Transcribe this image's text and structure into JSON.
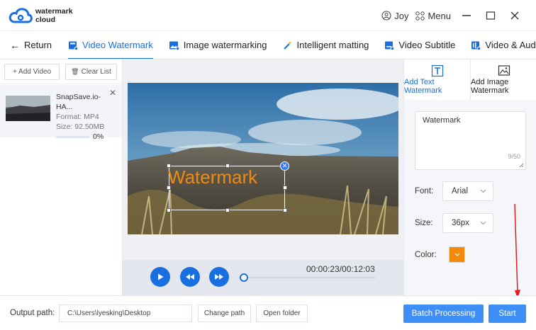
{
  "app": {
    "logo_line1": "watermark",
    "logo_line2": "cloud",
    "brand_color": "#1a6fe0"
  },
  "header": {
    "user_name": "Joy",
    "menu_label": "Menu"
  },
  "tabs": {
    "return_label": "Return",
    "items": [
      {
        "label": "Video Watermark",
        "active": true
      },
      {
        "label": "Image watermarking",
        "active": false
      },
      {
        "label": "Intelligent matting",
        "active": false
      },
      {
        "label": "Video Subtitle",
        "active": false
      },
      {
        "label": "Video & Audio Sepa",
        "active": false
      }
    ]
  },
  "left": {
    "add_video": "+ Add Video",
    "clear_list": "Clear List",
    "file": {
      "name": "SnapSave.io-HA...",
      "format": "Format:  MP4",
      "size": "Size:  92.50MB",
      "progress_text": "0%",
      "progress": 0
    }
  },
  "preview": {
    "watermark_text": "Watermark",
    "watermark_color": "#f08a10",
    "time": "00:00:23/00:12:03"
  },
  "right": {
    "tab_text": "Add Text Watermark",
    "tab_image": "Add Image Watermark",
    "text_value": "Watermark",
    "counter": "9/50",
    "font_label": "Font:",
    "font_value": "Arial",
    "size_label": "Size:",
    "size_value": "36px",
    "color_label": "Color:",
    "color_value": "#f28b0c"
  },
  "footer": {
    "output_label": "Output path:",
    "output_path": "C:\\Users\\lyesking\\Desktop",
    "change_path": "Change path",
    "open_folder": "Open folder",
    "batch": "Batch Processing",
    "start": "Start"
  }
}
